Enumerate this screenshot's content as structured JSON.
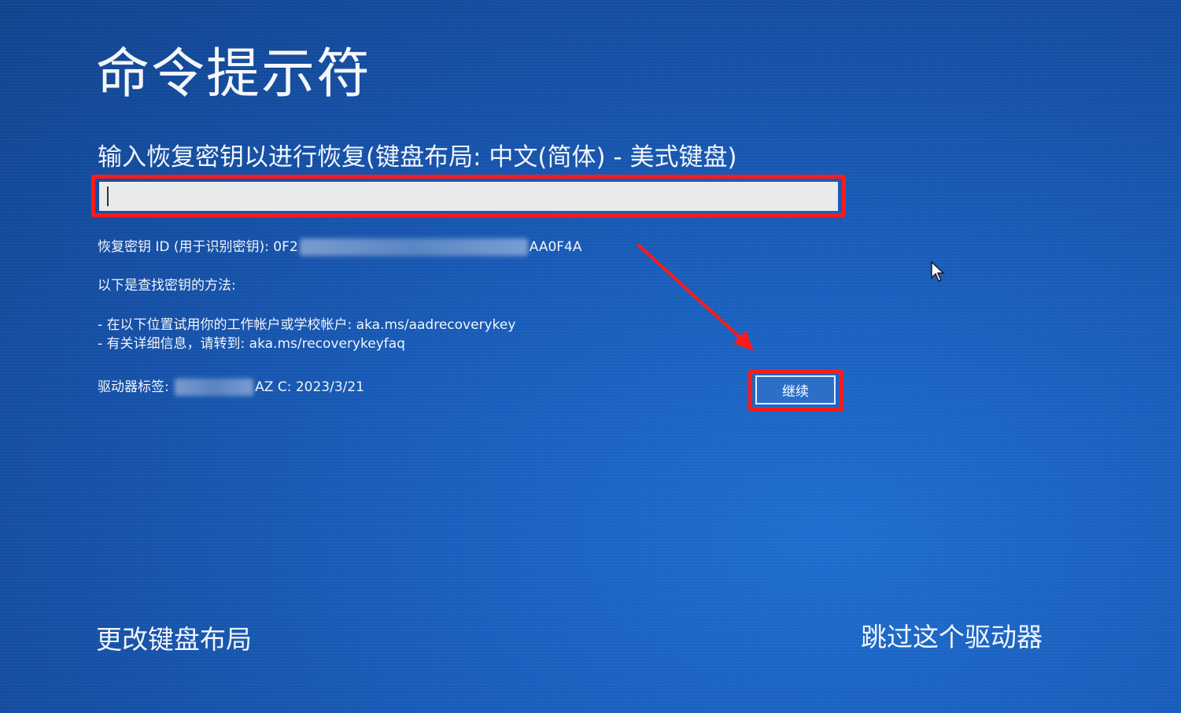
{
  "title": "命令提示符",
  "prompt": "输入恢复密钥以进行恢复(键盘布局: 中文(简体) - 美式键盘)",
  "recovery_key_input": {
    "value": ""
  },
  "key_id": {
    "prefix": "恢复密钥 ID (用于识别密钥): 0F2",
    "suffix": "AA0F4A"
  },
  "help": {
    "heading": "以下是查找密钥的方法:",
    "line1": "- 在以下位置试用你的工作帐户或学校帐户: aka.ms/aadrecoverykey",
    "line2": "- 有关详细信息，请转到: aka.ms/recoverykeyfaq"
  },
  "drive_label": {
    "prefix": "驱动器标签: ",
    "suffix": "AZ C: 2023/3/21"
  },
  "continue_label": "继续",
  "bottom": {
    "change_layout": "更改键盘布局",
    "skip_drive": "跳过这个驱动器"
  },
  "colors": {
    "background": "#1a5fbe",
    "annotation_red": "#ff1a1a",
    "text": "#f1f5fa"
  },
  "icons": {
    "cursor": "mouse-pointer-icon",
    "annotation": "red-arrow-icon"
  }
}
